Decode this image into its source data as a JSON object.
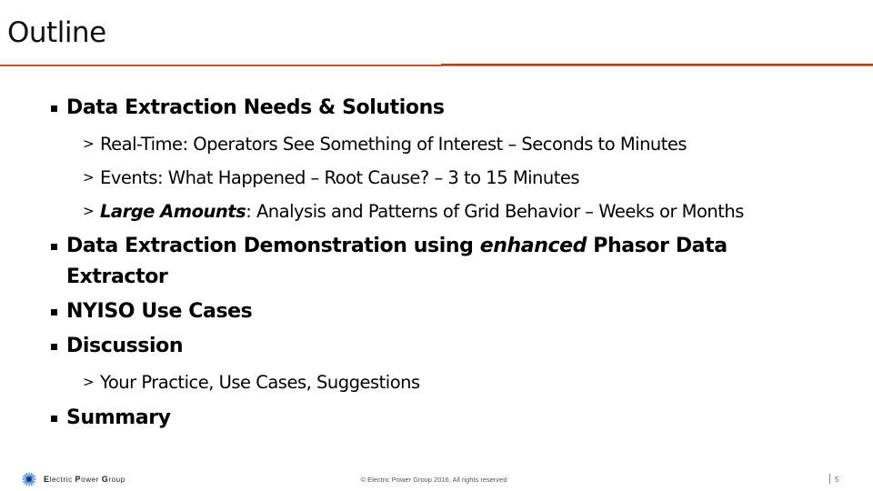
{
  "slide": {
    "title": "Outline",
    "accent_color": "#c4532d"
  },
  "outline": {
    "item1": {
      "label": "Data Extraction Needs & Solutions",
      "subitems": [
        {
          "prefix": "",
          "emphasis": "",
          "text": "Real-Time: Operators See Something of Interest – Seconds to Minutes"
        },
        {
          "prefix": "",
          "emphasis": "",
          "text": "Events: What Happened – Root Cause? – 3 to 15 Minutes"
        },
        {
          "prefix": "",
          "emphasis": "Large Amounts",
          "text": ": Analysis and Patterns of Grid Behavior – Weeks or Months"
        }
      ]
    },
    "item2": {
      "label_before": "Data Extraction Demonstration using ",
      "label_emphasis": "enhanced",
      "label_after": " Phasor Data",
      "label_wrap": "Extractor"
    },
    "item3": {
      "label": "NYISO Use Cases"
    },
    "item4": {
      "label": "Discussion",
      "subitems": [
        {
          "text": "Your Practice, Use Cases, Suggestions"
        }
      ]
    },
    "item5": {
      "label": "Summary"
    },
    "sub_marker": ">"
  },
  "footer": {
    "logo_icon": "starburst-icon",
    "logo_parts": [
      "E",
      "lectric ",
      "P",
      "ower ",
      "G",
      "roup"
    ],
    "copyright": "© Electric Power Group 2016. All rights reserved",
    "page_number": "5"
  }
}
